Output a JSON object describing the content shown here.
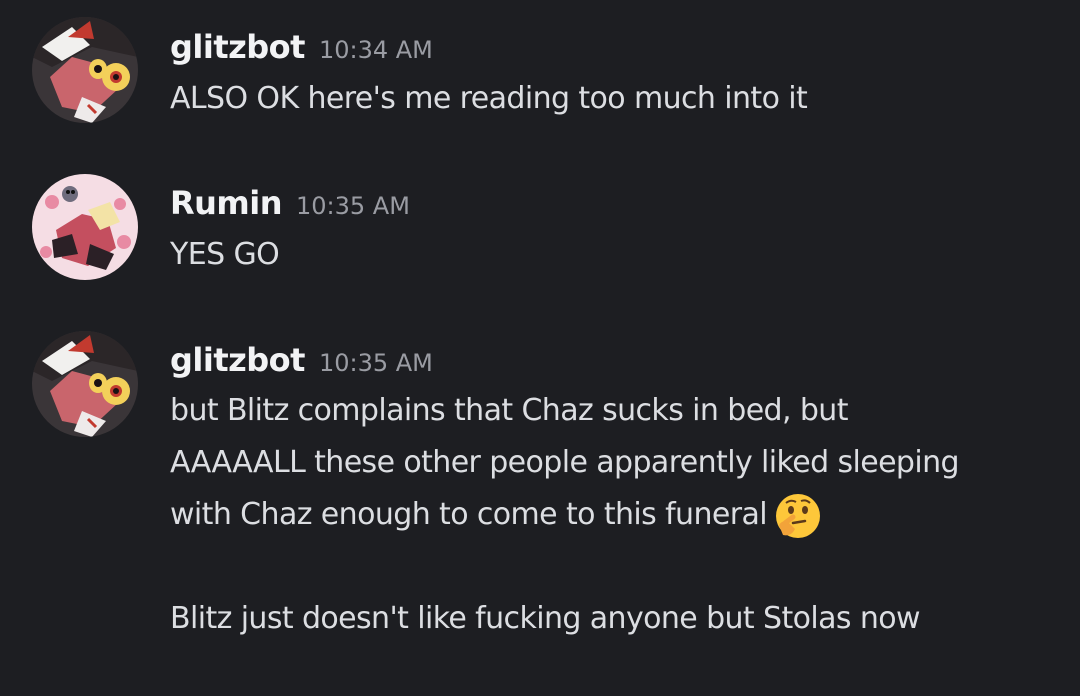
{
  "messages": [
    {
      "author": "glitzbot",
      "time": "10:34 AM",
      "lines": [
        "ALSO OK here's me reading too much into it"
      ],
      "avatar_icon": "glitzbot-avatar",
      "author_color": "#f2f3f5"
    },
    {
      "author": "Rumin",
      "time": "10:35 AM",
      "lines": [
        "YES GO"
      ],
      "avatar_icon": "rumin-avatar",
      "author_color": "#f2f3f5"
    },
    {
      "author": "glitzbot",
      "time": "10:35 AM",
      "lines": [
        "but Blitz complains that Chaz sucks in bed, but",
        "AAAAALL these other people apparently liked sleeping",
        "with Chaz enough to come to this funeral",
        "Blitz just doesn't like fucking anyone but Stolas now"
      ],
      "emoji": "thinking-face-emoji",
      "avatar_icon": "glitzbot-avatar",
      "author_color": "#f2f3f5"
    }
  ],
  "colors": {
    "background": "#1d1e22",
    "text": "#dcdee2",
    "timestamp": "#9a9ca3"
  }
}
